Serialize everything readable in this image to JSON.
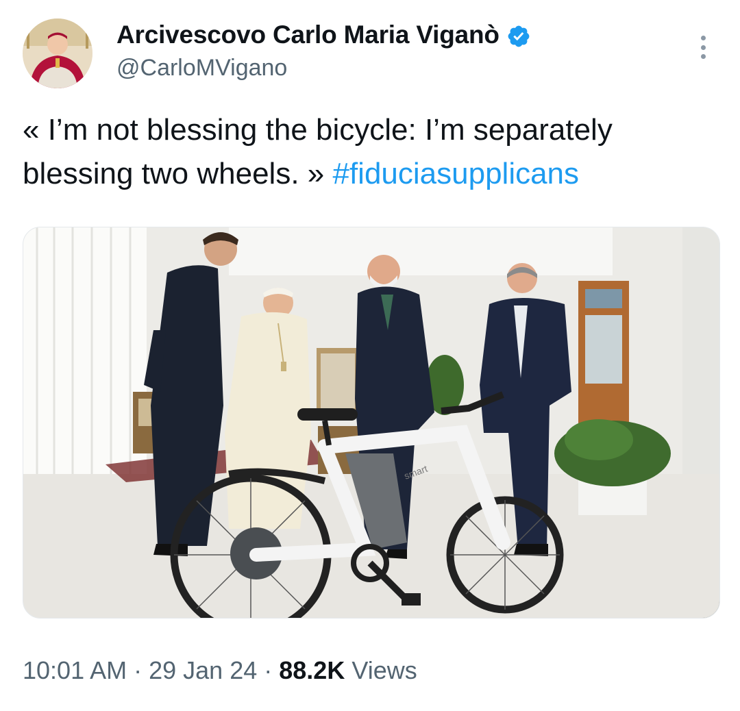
{
  "author": {
    "display_name": "Arcivescovo Carlo Maria Viganò",
    "handle": "@CarloMVigano",
    "verified_icon": "verified-badge-icon",
    "avatar_icon": "avatar-photo"
  },
  "tweet": {
    "text": "« I’m not blessing the bicycle: I’m separately blessing two wheels. » ",
    "hashtag": "#fiduciasupplicans"
  },
  "media": {
    "bike_brand_text": "smart"
  },
  "meta": {
    "time": "10:01 AM",
    "sep1": " · ",
    "date": "29 Jan 24",
    "sep2": " · ",
    "views_count": "88.2K",
    "views_label": " Views"
  },
  "colors": {
    "hashtag": "#1d9bf0",
    "verified": "#1d9bf0",
    "secondary_text": "#536471"
  }
}
